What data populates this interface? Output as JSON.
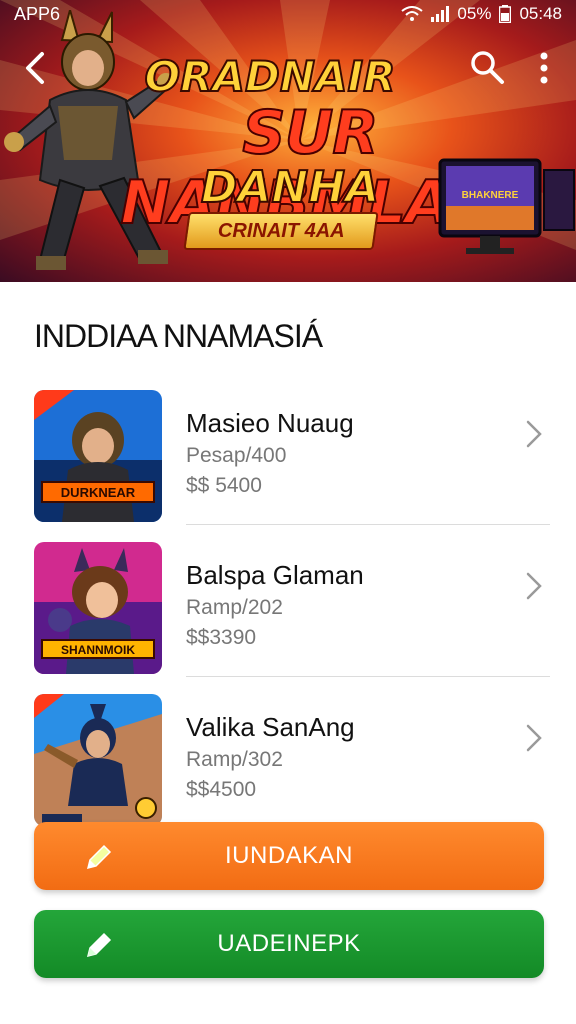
{
  "status_bar": {
    "app_label": "APP6",
    "battery": "05%",
    "time": "05:48"
  },
  "banner": {
    "line1": "ORADNAIR",
    "line2": "SUR NANBMLAN",
    "line3": "DANHA",
    "ribbon": "CRINAIT 4AA",
    "monitor_text": "BHAKNERE"
  },
  "section": {
    "title": "INDDIAA NNAMASIÁ"
  },
  "items": [
    {
      "name": "Masieo Nuaug",
      "sub": "Pesap/400",
      "price": "$$ 5400",
      "thumb_text": "DURKNEAR",
      "colors": [
        "#1d6fd6",
        "#0c2f6b",
        "#ff6a00"
      ]
    },
    {
      "name": "Balspa Glaman",
      "sub": "Ramp/202",
      "price": "$$3390",
      "thumb_text": "SHANNMOIK",
      "colors": [
        "#d12a8f",
        "#5a1a8a",
        "#ffb300"
      ]
    },
    {
      "name": "Valika SanAng",
      "sub": "Ramp/302",
      "price": "$$4500",
      "thumb_text": "",
      "colors": [
        "#2a8fe6",
        "#ff7a1a",
        "#1a2a55"
      ]
    }
  ],
  "buttons": {
    "primary_label": "IUNDAKAN",
    "secondary_label": "UADEINEPK"
  },
  "theme": {
    "orange": "#f26c13",
    "green": "#138a26"
  }
}
